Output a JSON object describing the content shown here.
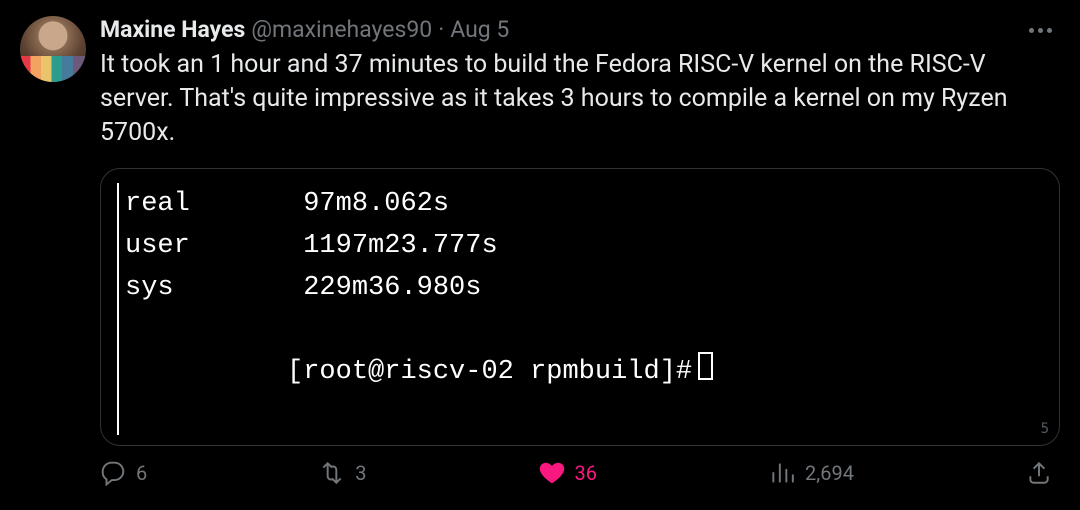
{
  "author": {
    "display_name": "Maxine Hayes",
    "handle": "@maxinehayes90",
    "sep": "·",
    "date": "Aug 5"
  },
  "body": "It took an 1 hour and 37 minutes to build the Fedora RISC-V kernel on the RISC-V server. That's quite impressive as it takes 3 hours to compile a kernel on my Ryzen 5700x.",
  "terminal": {
    "lines": [
      "real       97m8.062s",
      "user       1197m23.777s",
      "sys        229m36.980s"
    ],
    "prompt": "[root@riscv-02 rpmbuild]#",
    "corner": "5"
  },
  "metrics": {
    "replies": "6",
    "retweets": "3",
    "likes": "36",
    "views": "2,694"
  }
}
